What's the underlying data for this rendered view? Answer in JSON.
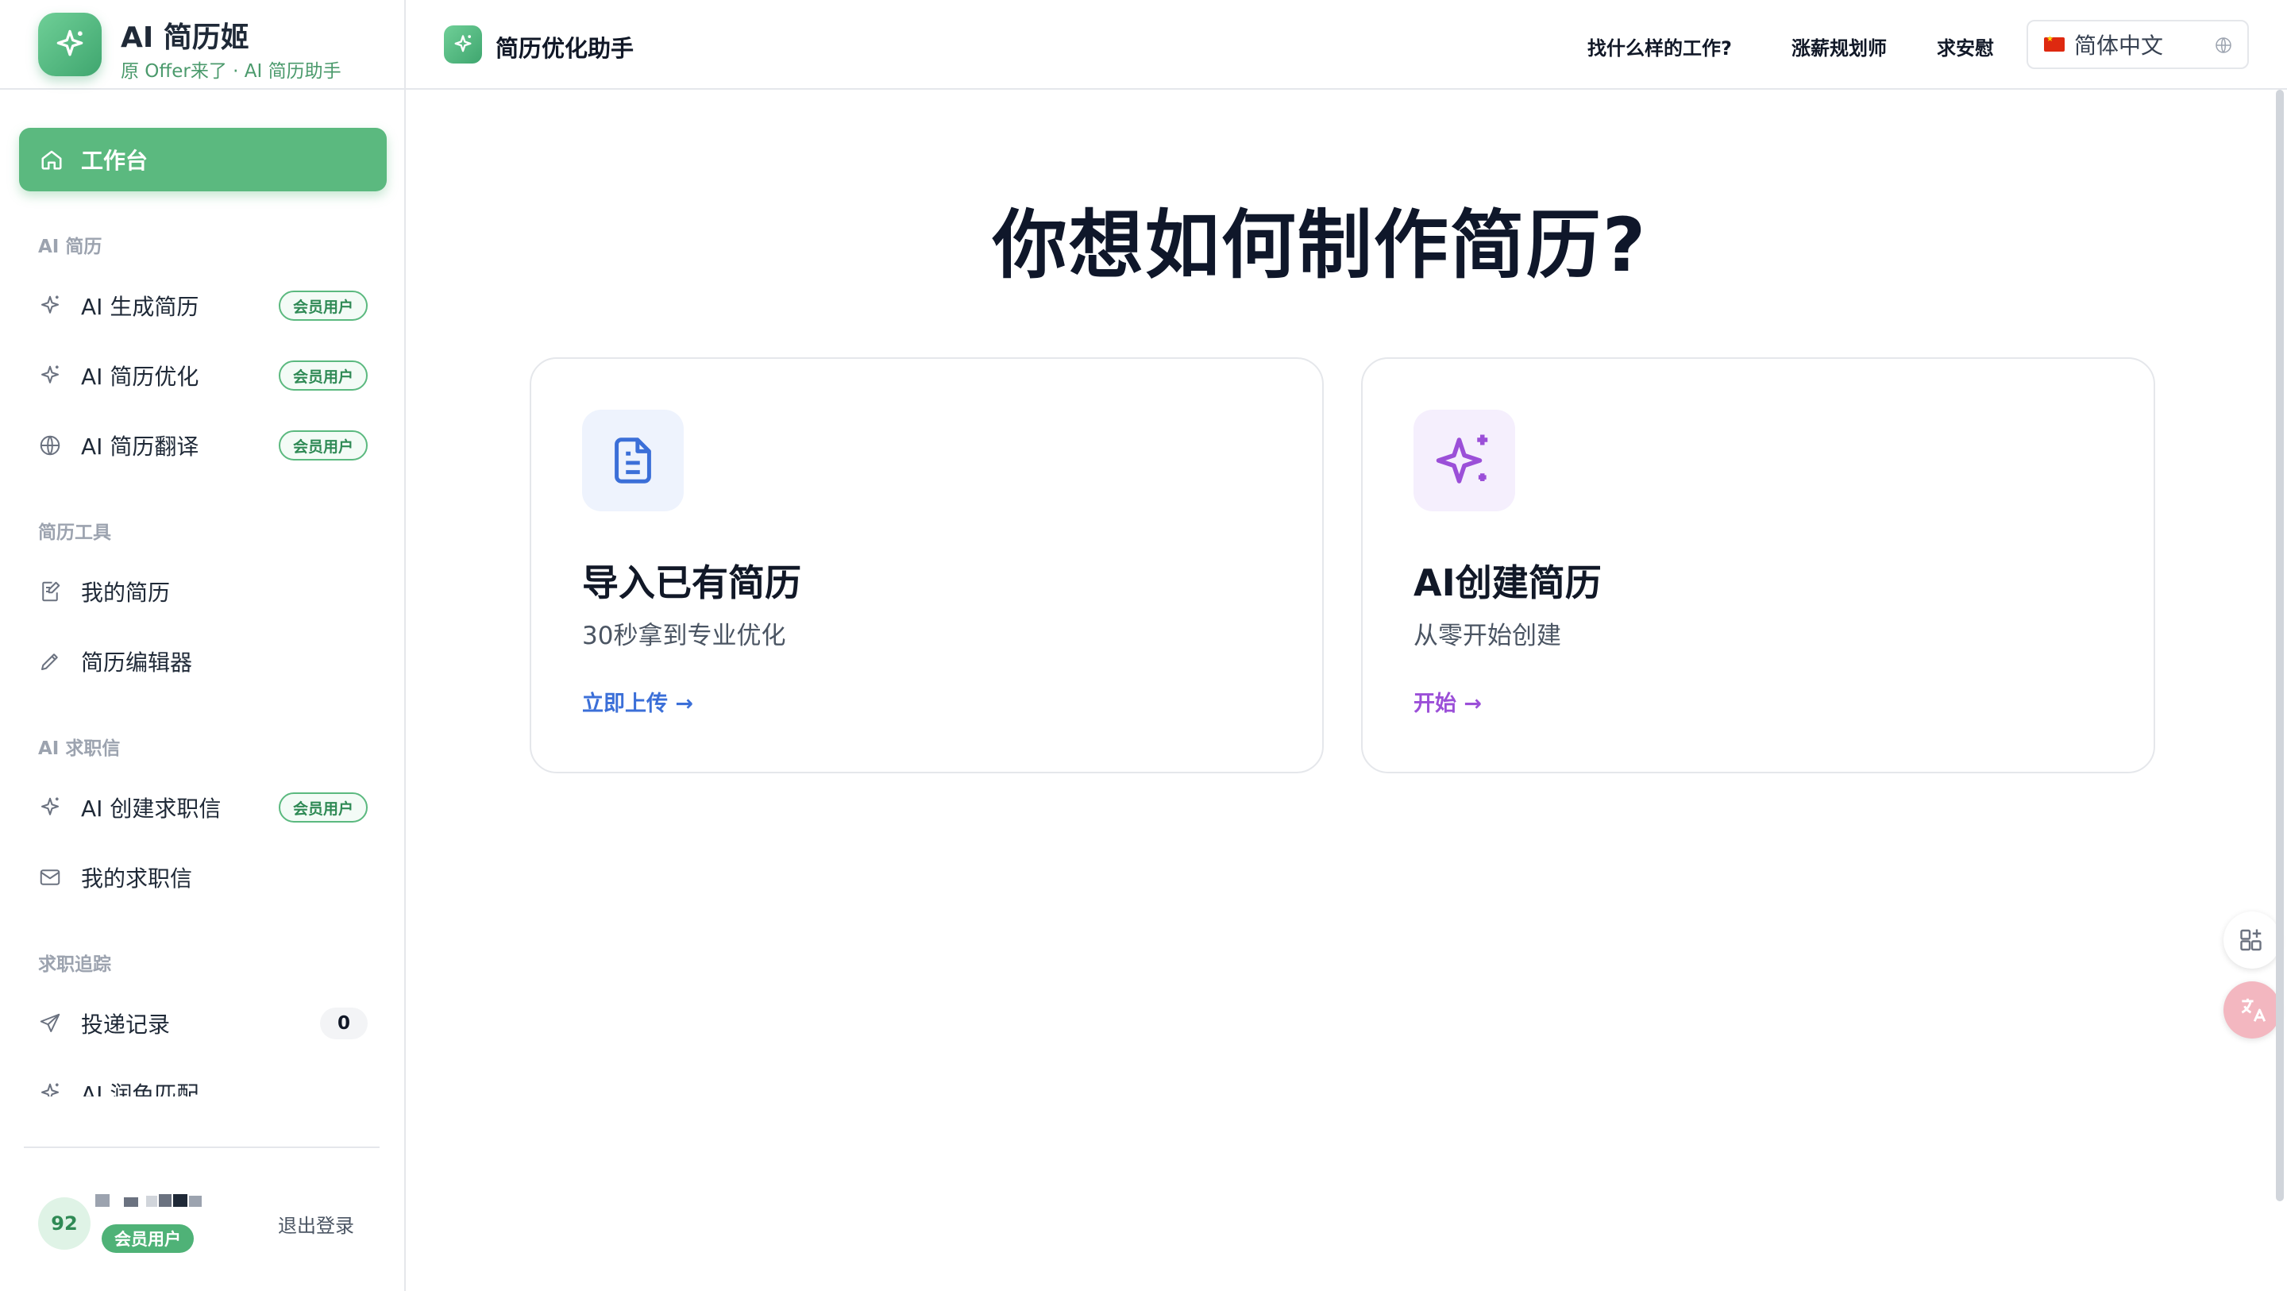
{
  "brand": {
    "title": "AI 简历姬",
    "subtitle": "原 Offer来了 · AI 简历助手"
  },
  "sidebar": {
    "active": {
      "label": "工作台",
      "icon": "home-icon"
    },
    "sections": [
      {
        "title": "AI 简历",
        "items": [
          {
            "label": "AI 生成简历",
            "icon": "sparkle-icon",
            "badge": "会员用户"
          },
          {
            "label": "AI 简历优化",
            "icon": "sparkle-icon",
            "badge": "会员用户"
          },
          {
            "label": "AI 简历翻译",
            "icon": "globe-icon",
            "badge": "会员用户"
          }
        ]
      },
      {
        "title": "简历工具",
        "items": [
          {
            "label": "我的简历",
            "icon": "document-edit-icon"
          },
          {
            "label": "简历编辑器",
            "icon": "pencil-icon"
          }
        ]
      },
      {
        "title": "AI 求职信",
        "items": [
          {
            "label": "AI 创建求职信",
            "icon": "sparkle-icon",
            "badge": "会员用户"
          },
          {
            "label": "我的求职信",
            "icon": "mail-icon"
          }
        ]
      },
      {
        "title": "求职追踪",
        "items": [
          {
            "label": "投递记录",
            "icon": "send-icon",
            "count": "0"
          },
          {
            "label": "AI 润色匹配",
            "icon": "sparkle-icon"
          }
        ]
      }
    ]
  },
  "user": {
    "avatar_text": "92",
    "badge": "会员用户",
    "logout": "退出登录"
  },
  "topbar": {
    "title": "简历优化助手",
    "links": [
      "找什么样的工作?",
      "涨薪规划师",
      "求安慰"
    ],
    "language": "简体中文"
  },
  "main": {
    "headline": "你想如何制作简历?",
    "cards": [
      {
        "title": "导入已有简历",
        "desc": "30秒拿到专业优化",
        "link": "立即上传 →",
        "icon": "document-icon",
        "accent": "#3b6fd8",
        "icon_bg": "#eef3fd"
      },
      {
        "title": "AI创建简历",
        "desc": "从零开始创建",
        "link": "开始 →",
        "icon": "sparkles-icon",
        "accent": "#9b4fd8",
        "icon_bg": "#f5effd"
      }
    ]
  },
  "colors": {
    "brand_green": "#5bb97f",
    "badge_green": "#2f8a55"
  }
}
